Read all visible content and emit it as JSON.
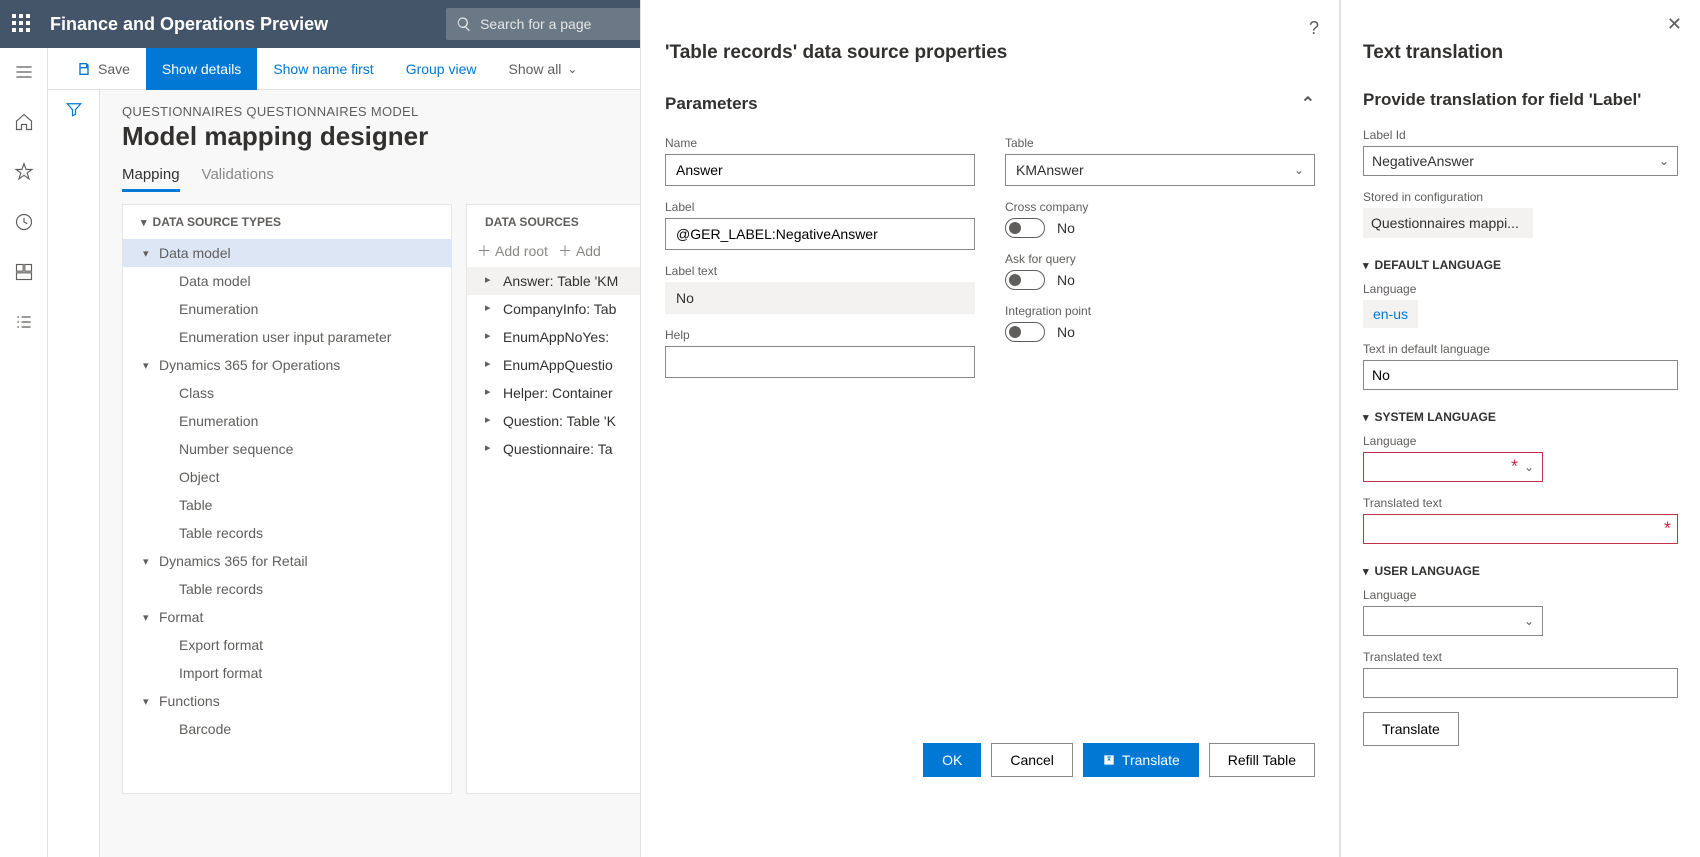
{
  "header": {
    "app_title": "Finance and Operations Preview",
    "search_placeholder": "Search for a page"
  },
  "toolbar": {
    "save": "Save",
    "show_details": "Show details",
    "show_name_first": "Show name first",
    "group_view": "Group view",
    "show_all": "Show all"
  },
  "page": {
    "breadcrumb": "QUESTIONNAIRES QUESTIONNAIRES MODEL",
    "title": "Model mapping designer",
    "tabs": {
      "mapping": "Mapping",
      "validations": "Validations"
    }
  },
  "panels": {
    "dst_header": "DATA SOURCE TYPES",
    "ds_header": "DATA SOURCES",
    "add_root": "Add root",
    "add": "Add",
    "dst_tree": [
      {
        "lvl": 1,
        "label": "Data model",
        "caret": "▾",
        "selected": true
      },
      {
        "lvl": 2,
        "label": "Data model"
      },
      {
        "lvl": 2,
        "label": "Enumeration"
      },
      {
        "lvl": 2,
        "label": "Enumeration user input parameter"
      },
      {
        "lvl": 1,
        "label": "Dynamics 365 for Operations",
        "caret": "▾"
      },
      {
        "lvl": 2,
        "label": "Class"
      },
      {
        "lvl": 2,
        "label": "Enumeration"
      },
      {
        "lvl": 2,
        "label": "Number sequence"
      },
      {
        "lvl": 2,
        "label": "Object"
      },
      {
        "lvl": 2,
        "label": "Table"
      },
      {
        "lvl": 2,
        "label": "Table records"
      },
      {
        "lvl": 1,
        "label": "Dynamics 365 for Retail",
        "caret": "▾"
      },
      {
        "lvl": 2,
        "label": "Table records"
      },
      {
        "lvl": 1,
        "label": "Format",
        "caret": "▾"
      },
      {
        "lvl": 2,
        "label": "Export format"
      },
      {
        "lvl": 2,
        "label": "Import format"
      },
      {
        "lvl": 1,
        "label": "Functions",
        "caret": "▾"
      },
      {
        "lvl": 2,
        "label": "Barcode"
      }
    ],
    "ds_tree": [
      {
        "label": "Answer: Table 'KM",
        "sel": true
      },
      {
        "label": "CompanyInfo: Tab"
      },
      {
        "label": "EnumAppNoYes: "
      },
      {
        "label": "EnumAppQuestio"
      },
      {
        "label": "Helper: Container"
      },
      {
        "label": "Question: Table 'K"
      },
      {
        "label": "Questionnaire: Ta"
      }
    ]
  },
  "dialog": {
    "title": "'Table records' data source properties",
    "section": "Parameters",
    "name_lbl": "Name",
    "name_val": "Answer",
    "label_lbl": "Label",
    "label_val": "@GER_LABEL:NegativeAnswer",
    "labeltext_lbl": "Label text",
    "labeltext_val": "No",
    "help_lbl": "Help",
    "help_val": "",
    "table_lbl": "Table",
    "table_val": "KMAnswer",
    "cross_lbl": "Cross company",
    "cross_val": "No",
    "ask_lbl": "Ask for query",
    "ask_val": "No",
    "int_lbl": "Integration point",
    "int_val": "No",
    "btn_ok": "OK",
    "btn_cancel": "Cancel",
    "btn_translate": "Translate",
    "btn_refill": "Refill Table"
  },
  "translation": {
    "title": "Text translation",
    "subtitle": "Provide translation for field 'Label'",
    "labelid_lbl": "Label Id",
    "labelid_val": "NegativeAnswer",
    "stored_lbl": "Stored in configuration",
    "stored_val": "Questionnaires mappi...",
    "sec_default": "DEFAULT LANGUAGE",
    "lang_lbl": "Language",
    "default_lang_val": "en-us",
    "text_default_lbl": "Text in default language",
    "text_default_val": "No",
    "sec_system": "SYSTEM LANGUAGE",
    "sys_lang_val": "",
    "translated_lbl": "Translated text",
    "sys_translated_val": "",
    "sec_user": "USER LANGUAGE",
    "user_lang_val": "",
    "user_translated_val": "",
    "btn_translate": "Translate"
  }
}
